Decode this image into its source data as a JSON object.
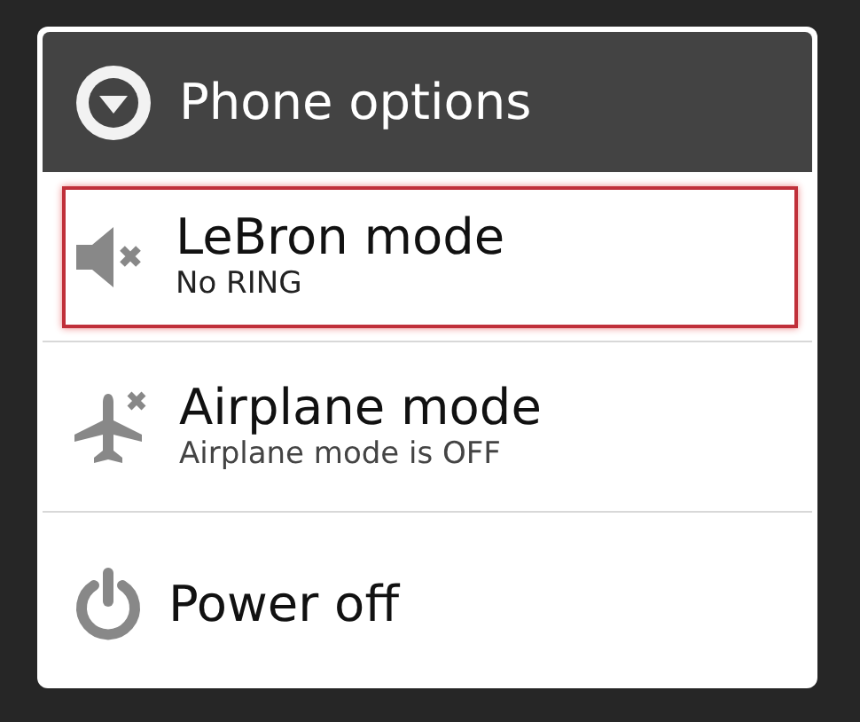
{
  "dialog": {
    "title": "Phone options",
    "items": [
      {
        "kind": "silent",
        "label": "LeBron mode",
        "subtitle": "No RING",
        "selected": true
      },
      {
        "kind": "airplane",
        "label": "Airplane mode",
        "subtitle": "Airplane mode is OFF",
        "selected": false
      },
      {
        "kind": "power",
        "label": "Power off",
        "selected": false
      }
    ]
  }
}
